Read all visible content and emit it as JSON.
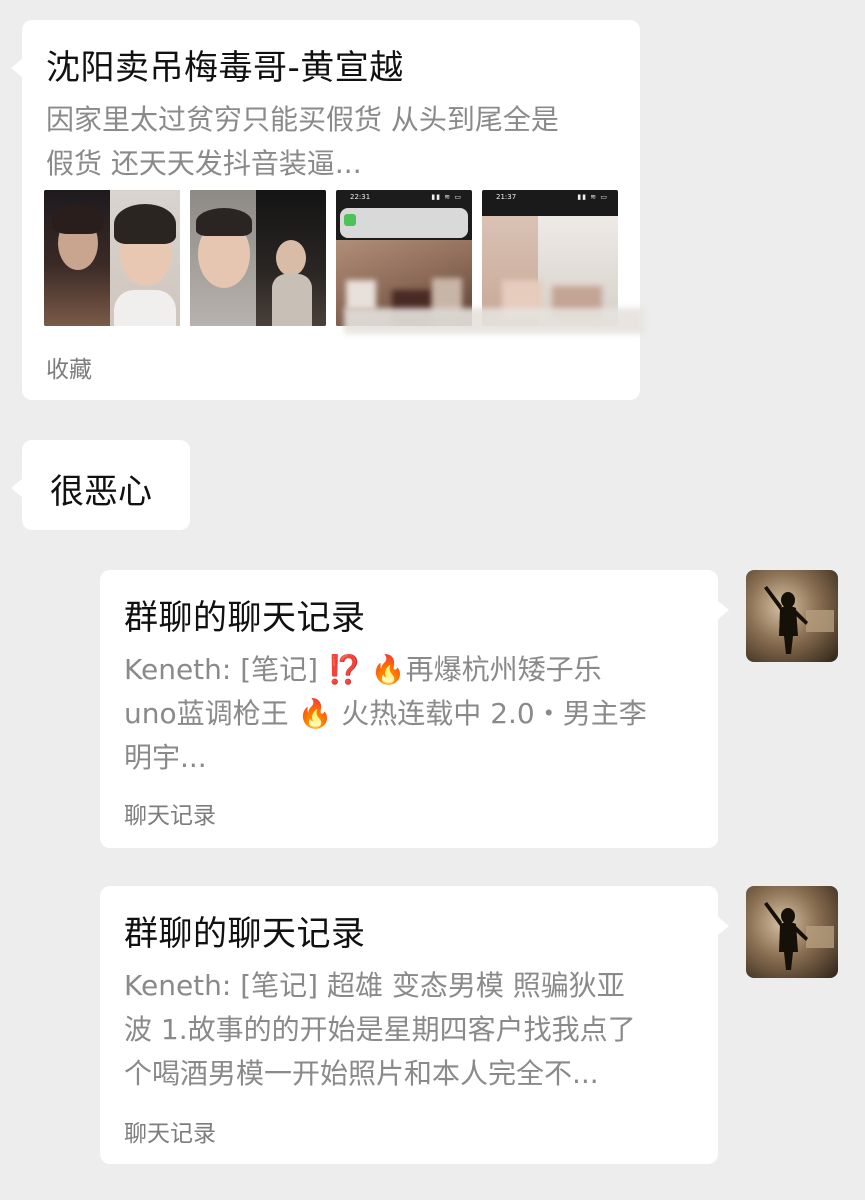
{
  "messages": {
    "link_card": {
      "title": "沈阳卖吊梅毒哥-黄宣越",
      "desc_line1": "因家里太过贫穷只能买假货 从头到尾全是",
      "desc_line2": "假货 还天天发抖音装逼...",
      "source": "收藏",
      "thumbnails": [
        {
          "kind": "face-collage-1",
          "status_time": "",
          "caption": ""
        },
        {
          "kind": "face-collage-2",
          "status_time": "",
          "caption": ""
        },
        {
          "kind": "phone-screenshot-blurred",
          "status_time": "22:31",
          "caption": ""
        },
        {
          "kind": "phone-screenshot-blurred",
          "status_time": "21:37",
          "caption": ""
        }
      ]
    },
    "text_message": {
      "text": "很恶心"
    },
    "chat_record_1": {
      "title": "群聊的聊天记录",
      "line1": "Keneth: [笔记] ⁉️ 🔥再爆杭州矮子乐",
      "line2": "uno蓝调枪王 🔥  火热连载中 2.0・男主李",
      "line3": "明宇...",
      "source": "聊天记录"
    },
    "chat_record_2": {
      "title": "群聊的聊天记录",
      "line1": "Keneth: [笔记] 超雄 变态男模 照骗狄亚",
      "line2": "波 1.故事的的开始是星期四客户找我点了",
      "line3": "个喝酒男模一开始照片和本人完全不...",
      "source": "聊天记录"
    }
  },
  "colors": {
    "background": "#ededed",
    "bubble": "#ffffff",
    "title_text": "#111111",
    "secondary_text": "#8a8a8a"
  },
  "icons": {
    "avatar": "shadow-figure-avatar-icon"
  }
}
